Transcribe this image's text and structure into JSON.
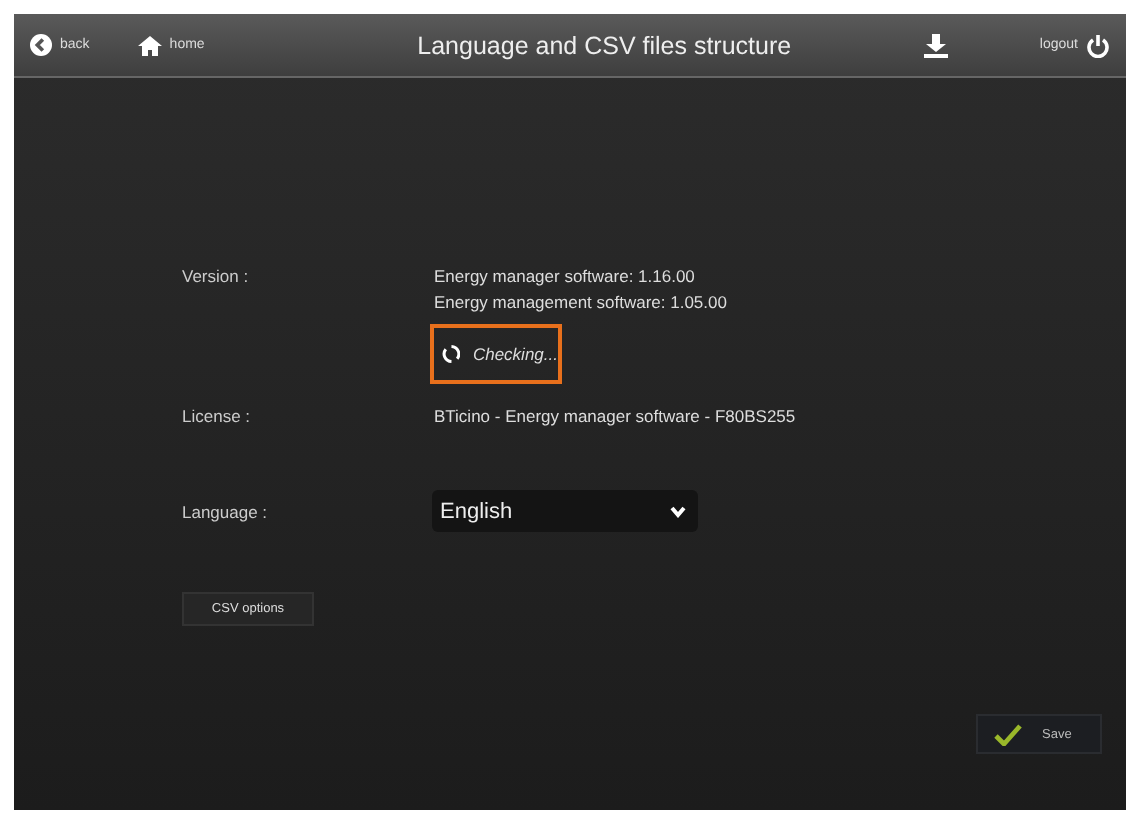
{
  "header": {
    "back": "back",
    "home": "home",
    "title": "Language and CSV files structure",
    "logout": "logout"
  },
  "version": {
    "label": "Version :",
    "lines": [
      "Energy manager software: 1.16.00",
      "Energy management software: 1.05.00"
    ],
    "status": "Checking..."
  },
  "license": {
    "label": "License :",
    "value": "BTicino - Energy manager software - F80BS255"
  },
  "language": {
    "label": "Language :",
    "value": "English"
  },
  "csv_button": "CSV options",
  "save_button": "Save"
}
